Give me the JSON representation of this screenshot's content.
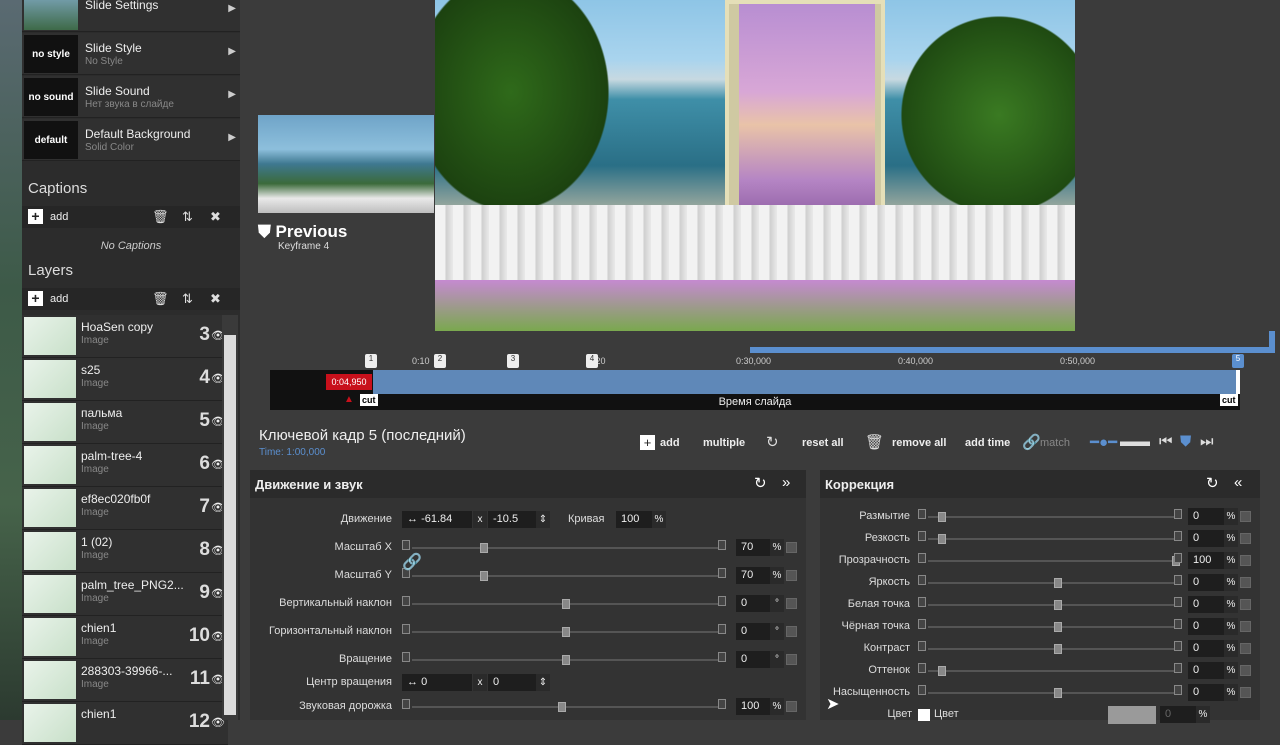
{
  "slide_rows": [
    {
      "thumb": "",
      "title": "Slide Settings",
      "sub": ""
    },
    {
      "thumb": "no style",
      "title": "Slide Style",
      "sub": "No Style"
    },
    {
      "thumb": "no sound",
      "title": "Slide Sound",
      "sub": "Нет звука в слайде"
    },
    {
      "thumb": "default",
      "title": "Default Background",
      "sub": "Solid Color"
    }
  ],
  "captions": {
    "title": "Captions",
    "add": "add",
    "empty": "No Captions"
  },
  "layers": {
    "title": "Layers",
    "add": "add",
    "items": [
      {
        "name": "HoaSen copy",
        "kind": "Image",
        "num": "3"
      },
      {
        "name": "s25",
        "kind": "Image",
        "num": "4"
      },
      {
        "name": "пальма",
        "kind": "Image",
        "num": "5"
      },
      {
        "name": "palm-tree-4",
        "kind": "Image",
        "num": "6"
      },
      {
        "name": "ef8ec020fb0f",
        "kind": "Image",
        "num": "7"
      },
      {
        "name": "1 (02)",
        "kind": "Image",
        "num": "8"
      },
      {
        "name": "palm_tree_PNG2...",
        "kind": "Image",
        "num": "9"
      },
      {
        "name": "chien1",
        "kind": "Image",
        "num": "10"
      },
      {
        "name": "288303-39966-...",
        "kind": "Image",
        "num": "11"
      },
      {
        "name": "chien1",
        "kind": "",
        "num": "12"
      }
    ]
  },
  "previous": {
    "label": "Previous",
    "sub": "Keyframe 4"
  },
  "timeline": {
    "ticks": [
      "0:10",
      "0:20",
      "0:30,000",
      "0:40,000",
      "0:50,000"
    ],
    "current": "0:04,950",
    "cut": "cut",
    "label": "Время слайда",
    "kf_labels": [
      "1",
      "2",
      "3",
      "4",
      "5"
    ]
  },
  "keyframe": {
    "title": "Ключевой кадр 5 (последний)",
    "time": "Time: 1:00,000"
  },
  "toolbar": {
    "add": "add",
    "multiple": "multiple",
    "reset": "reset all",
    "remove": "remove all",
    "add_time": "add time",
    "match": "match"
  },
  "motion": {
    "title": "Движение и звук",
    "move_label": "Движение",
    "move_x": "-61.84",
    "move_y": "-10.5",
    "curve_label": "Кривая",
    "curve_val": "100",
    "pct": "%",
    "rows": [
      {
        "label": "Масштаб X",
        "val": "70",
        "unit": "%"
      },
      {
        "label": "Масштаб Y",
        "val": "70",
        "unit": "%"
      },
      {
        "label": "Вертикальный наклон",
        "val": "0",
        "unit": "°"
      },
      {
        "label": "Горизонтальный наклон",
        "val": "0",
        "unit": "°"
      },
      {
        "label": "Вращение",
        "val": "0",
        "unit": "°"
      }
    ],
    "center_label": "Центр вращения",
    "center_x": "0",
    "center_y": "0",
    "audio_label": "Звуковая дорожка",
    "audio_val": "100",
    "x": "x"
  },
  "correction": {
    "title": "Коррекция",
    "rows": [
      {
        "label": "Размытие",
        "val": "0"
      },
      {
        "label": "Резкость",
        "val": "0"
      },
      {
        "label": "Прозрачность",
        "val": "100"
      },
      {
        "label": "Яркость",
        "val": "0"
      },
      {
        "label": "Белая точка",
        "val": "0"
      },
      {
        "label": "Чёрная точка",
        "val": "0"
      },
      {
        "label": "Контраст",
        "val": "0"
      },
      {
        "label": "Оттенок",
        "val": "0"
      },
      {
        "label": "Насыщенность",
        "val": "0"
      }
    ],
    "color_label": "Цвет",
    "color_label2": "Цвет",
    "color_val": "0",
    "pct": "%"
  }
}
